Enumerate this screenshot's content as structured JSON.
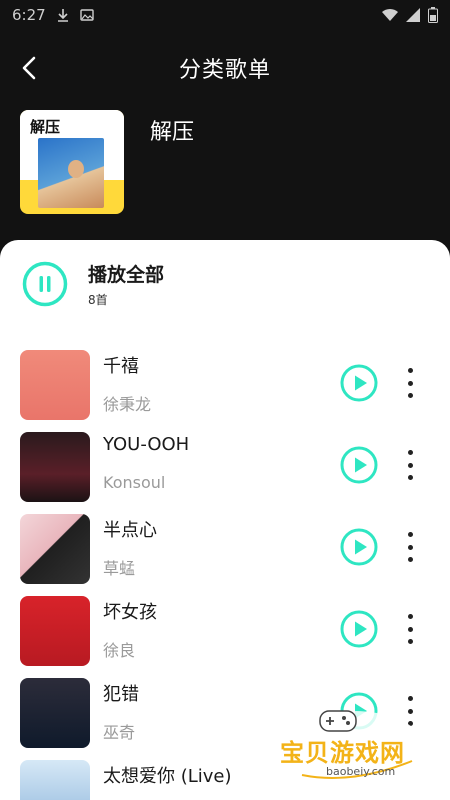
{
  "status_bar": {
    "time": "6:27"
  },
  "nav": {
    "title": "分类歌单"
  },
  "playlist": {
    "cover_title": "解压",
    "name": "解压"
  },
  "play_all": {
    "label": "播放全部",
    "count": "8首"
  },
  "songs": [
    {
      "title": "千禧",
      "artist": "徐秉龙"
    },
    {
      "title": "YOU-OOH",
      "artist": "Konsoul"
    },
    {
      "title": "半点心",
      "artist": "草蜢"
    },
    {
      "title": "坏女孩",
      "artist": "徐良"
    },
    {
      "title": "犯错",
      "artist": "巫奇"
    },
    {
      "title": "太想爱你 (Live)",
      "artist": ""
    }
  ],
  "watermark": {
    "text": "宝贝游戏网",
    "url": "baobeiy.com"
  },
  "colors": {
    "accent": "#2ee6c2",
    "background": "#121212",
    "panel": "#ffffff"
  }
}
